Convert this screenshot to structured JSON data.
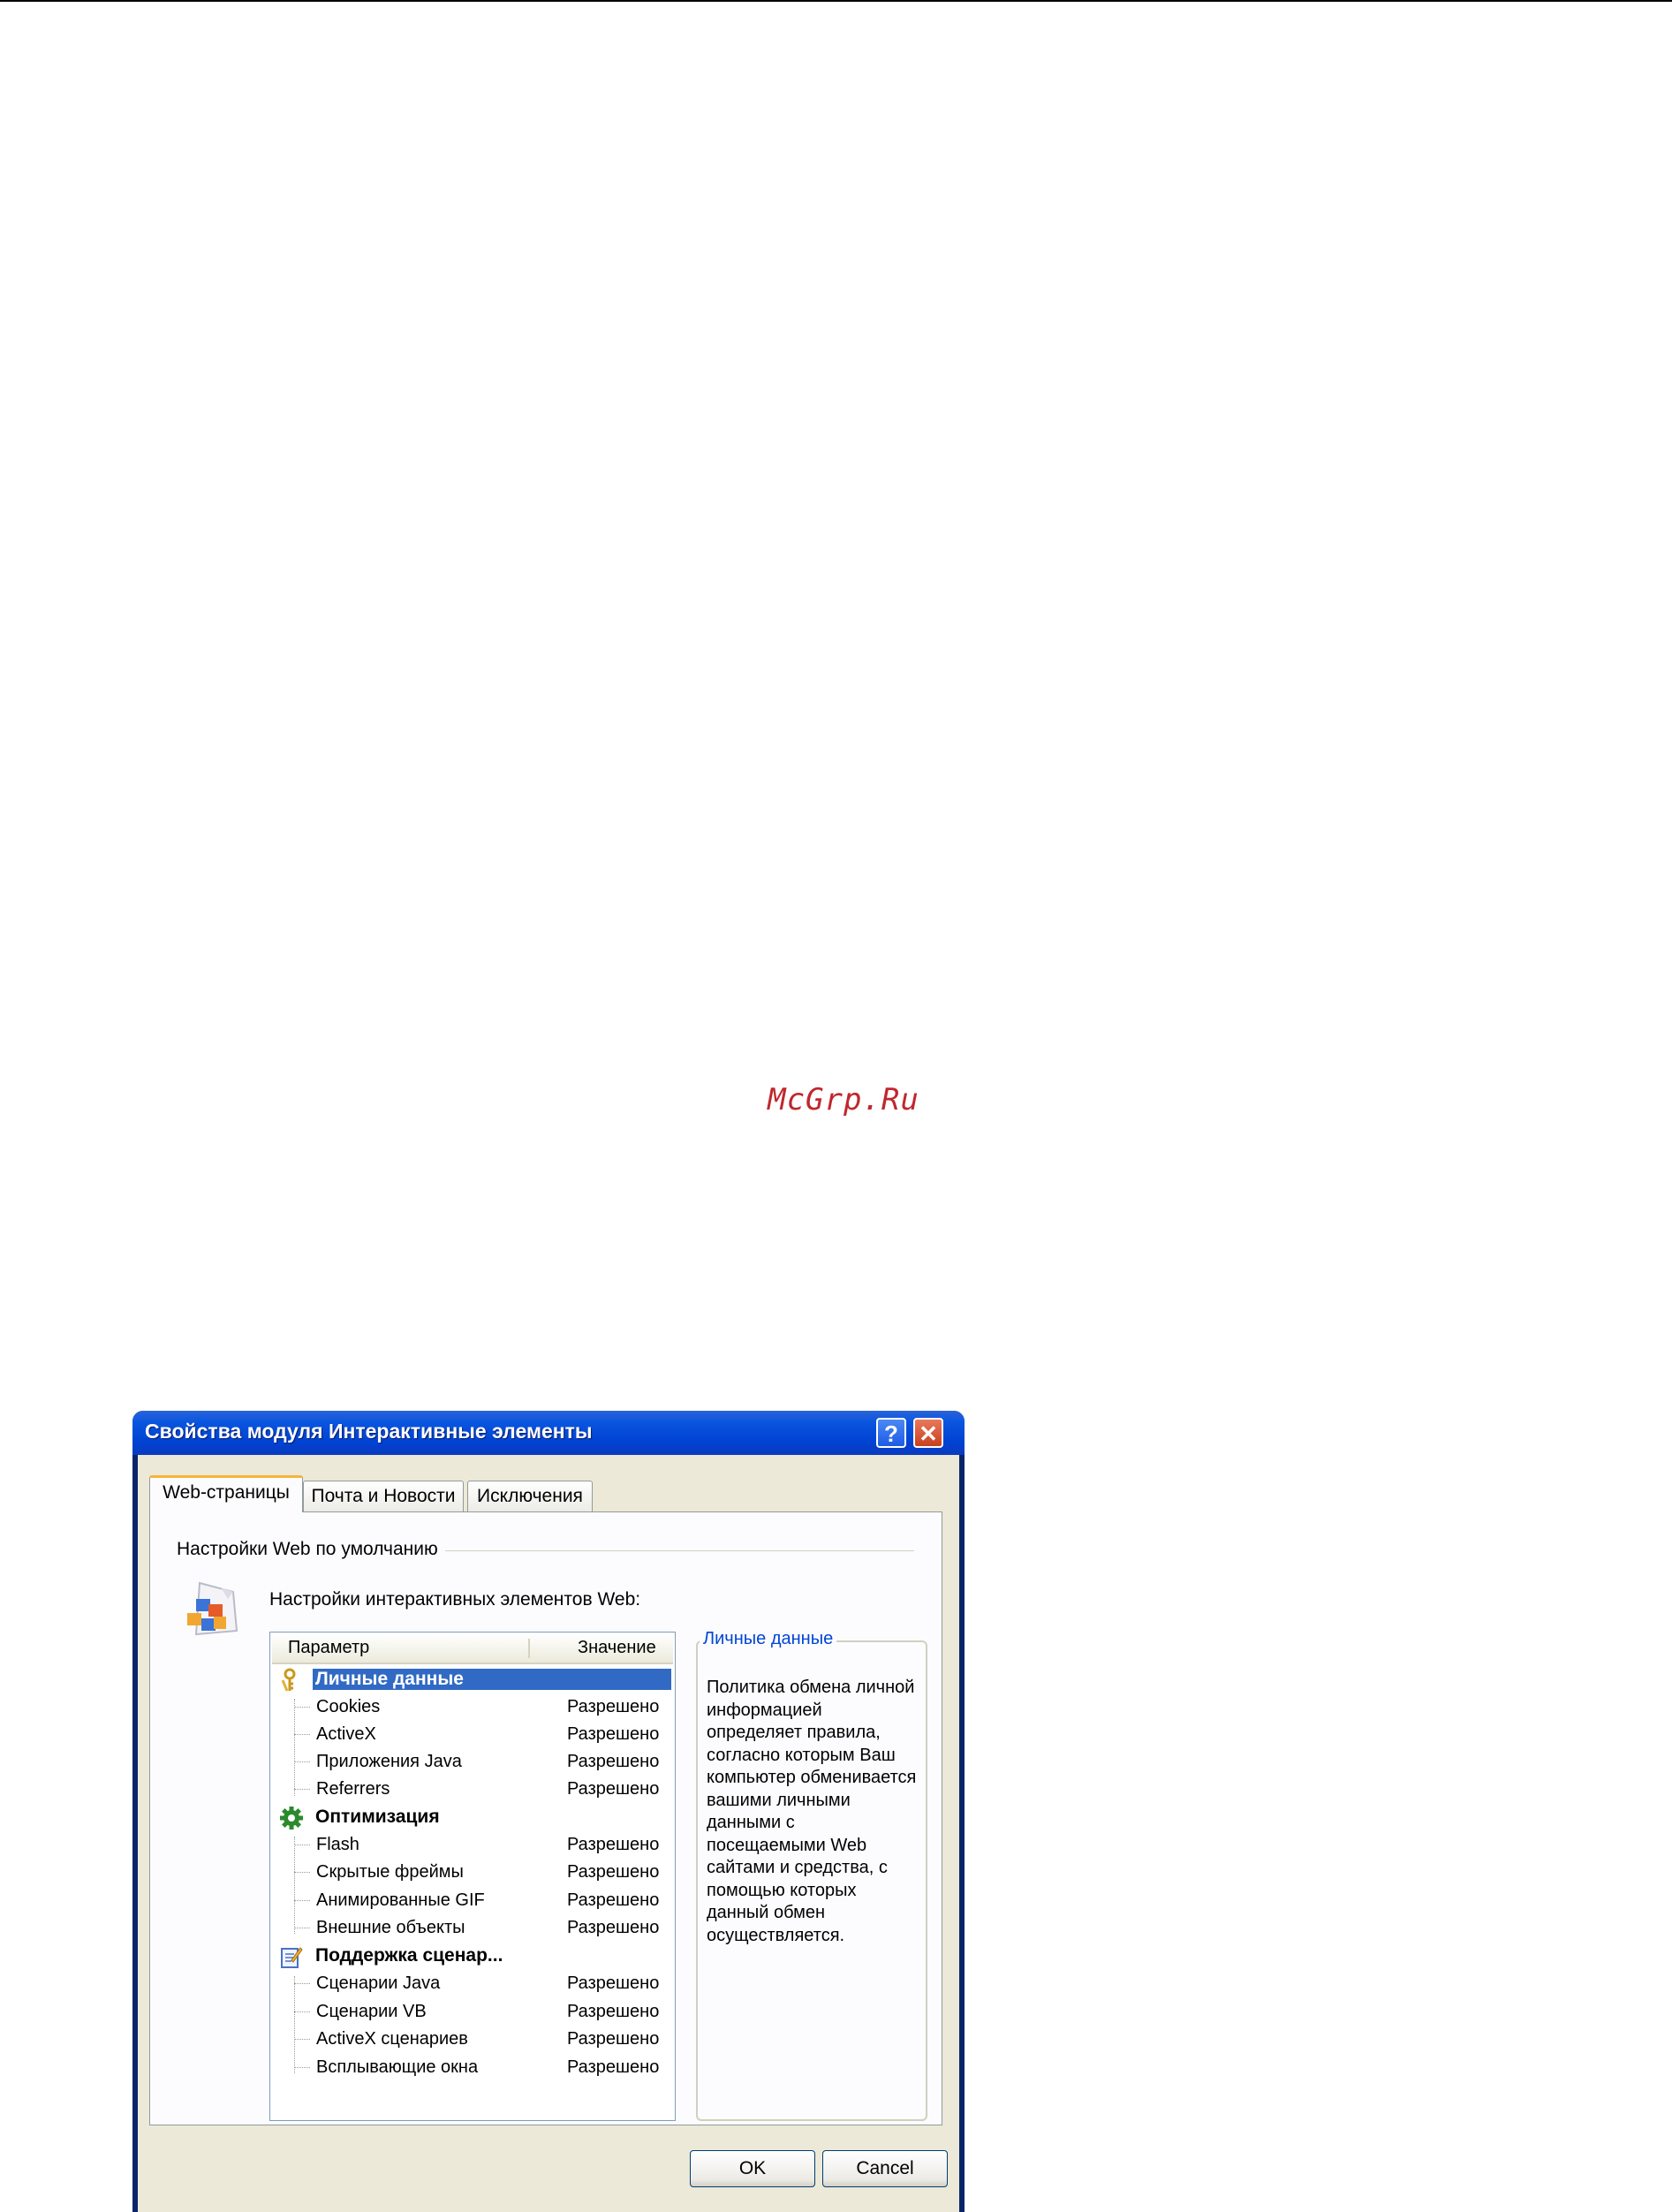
{
  "watermark": "McGrp.Ru",
  "dialog": {
    "title": "Свойства модуля Интерактивные элементы",
    "help_button": "?",
    "close_button": "✕",
    "tabs": [
      {
        "label": "Web-страницы",
        "active": true
      },
      {
        "label": "Почта и Новости",
        "active": false
      },
      {
        "label": "Исключения",
        "active": false
      }
    ],
    "group_label": "Настройки Web по умолчанию",
    "subtitle": "Настройки интерактивных элементов Web:",
    "list": {
      "columns": [
        "Параметр",
        "Значение"
      ],
      "categories": [
        {
          "name": "Личные данные",
          "icon": "keys-icon",
          "selected": true,
          "items": [
            {
              "name": "Cookies",
              "value": "Разрешено"
            },
            {
              "name": "ActiveX",
              "value": "Разрешено"
            },
            {
              "name": "Приложения Java",
              "value": "Разрешено"
            },
            {
              "name": "Referrers",
              "value": "Разрешено"
            }
          ]
        },
        {
          "name": "Оптимизация",
          "icon": "gear-icon",
          "selected": false,
          "items": [
            {
              "name": "Flash",
              "value": "Разрешено"
            },
            {
              "name": "Скрытые фреймы",
              "value": "Разрешено"
            },
            {
              "name": "Анимированные GIF",
              "value": "Разрешено"
            },
            {
              "name": "Внешние объекты",
              "value": "Разрешено"
            }
          ]
        },
        {
          "name": "Поддержка сценар...",
          "icon": "script-icon",
          "selected": false,
          "items": [
            {
              "name": "Сценарии Java",
              "value": "Разрешено"
            },
            {
              "name": "Сценарии VB",
              "value": "Разрешено"
            },
            {
              "name": "ActiveX сценариев",
              "value": "Разрешено"
            },
            {
              "name": "Всплывающие окна",
              "value": "Разрешено"
            }
          ]
        }
      ]
    },
    "description": {
      "title": "Личные данные",
      "text": "Политика обмена личной информацией определяет правила, согласно которым Ваш компьютер обменивается вашими личными данными с посещаемыми Web сайтами и средства, с помощью которых данный обмен осуществляется."
    },
    "ok_button": "OK",
    "cancel_button": "Cancel"
  }
}
